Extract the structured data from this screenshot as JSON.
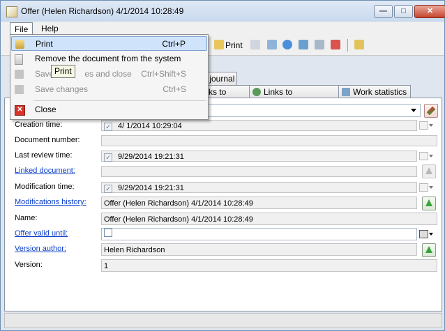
{
  "window": {
    "title": "Offer (Helen Richardson) 4/1/2014 10:28:49"
  },
  "menubar": {
    "file": "File",
    "help": "Help"
  },
  "toolbar": {
    "print_label": "Print"
  },
  "tabs": [
    {
      "label": "s journal"
    },
    {
      "label": "ks to Offers"
    },
    {
      "label": "Links to Agreements"
    },
    {
      "label": "Work statistics"
    }
  ],
  "file_menu": {
    "items": [
      {
        "label": "Print",
        "shortcut": "Ctrl+P",
        "icon": "printer-icon",
        "enabled": true
      },
      {
        "label": "Remove the document from the system",
        "shortcut": "",
        "icon": "remove-document-icon",
        "enabled": true
      },
      {
        "label_prefix": "Save",
        "label_suffix": "es and close",
        "shortcut": "Ctrl+Shift+S",
        "icon": "save-close-icon",
        "enabled": false
      },
      {
        "label": "Save changes",
        "shortcut": "Ctrl+S",
        "icon": "save-icon",
        "enabled": false
      },
      {
        "label": "Close",
        "shortcut": "",
        "icon": "close-icon",
        "enabled": true
      }
    ]
  },
  "tooltip": "Print",
  "form": {
    "creation_time": {
      "label": "Creation time:",
      "value": "4/  1/2014 10:29:04"
    },
    "document_number": {
      "label": "Document number:",
      "value": ""
    },
    "last_review_time": {
      "label": "Last review time:",
      "value": "9/29/2014 19:21:31"
    },
    "linked_document": {
      "label": "Linked document:",
      "value": ""
    },
    "modification_time": {
      "label": "Modification time:",
      "value": "9/29/2014 19:21:31"
    },
    "modifications_history": {
      "label": "Modifications history:",
      "value": "Offer (Helen Richardson) 4/1/2014 10:28:49"
    },
    "name": {
      "label": "Name:",
      "value": "Offer (Helen Richardson) 4/1/2014 10:28:49"
    },
    "offer_valid_until": {
      "label": "Offer valid until:",
      "value": ""
    },
    "version_author": {
      "label": "Version author:",
      "value": "Helen Richardson"
    },
    "version": {
      "label": "Version:",
      "value": "1"
    }
  }
}
